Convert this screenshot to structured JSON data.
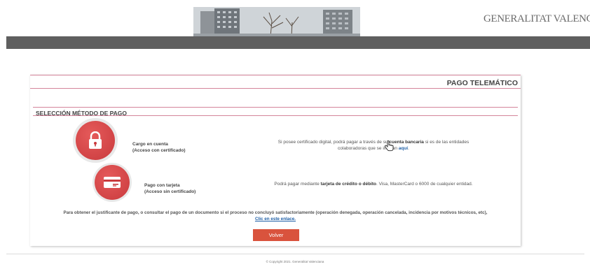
{
  "header": {
    "logo_text": "GENERALITAT VALENCIANA"
  },
  "panel": {
    "title": "PAGO TELEMÁTICO",
    "section_title": "SELECCIÓN MÉTODO DE PAGO",
    "options": [
      {
        "label_line1": "Cargo en cuenta",
        "label_line2": "(Acceso con certificado)",
        "desc_line1_pre": "Si posee certificado digital, podrá pagar a través de su ",
        "desc_line1_bold": "cuenta bancaria",
        "desc_line1_post": " si es de las entidades",
        "desc_line2_pre": "colaboradoras que se indican ",
        "desc_line2_link": "aquí",
        "desc_line2_post": ".",
        "icon": "lock-icon"
      },
      {
        "label_line1": "Pago con tarjeta",
        "label_line2": "(Acceso sin certificado)",
        "desc_pre": "Podrá pagar mediante ",
        "desc_bold": "tarjeta de crédito o débito",
        "desc_post": ". Visa, MasterCard o 6000 de cualquier entidad.",
        "icon": "credit-card-icon"
      }
    ],
    "justificante_text": "Para obtener el justificante de pago, o consultar el pago de un documento si el proceso no concluyó satisfactoriamente (operación denegada, operación cancelada, incidencia por motivos técnicos, etc),",
    "clic_link": "Clic en este enlace.",
    "volver_label": "Volver"
  },
  "footer": {
    "copyright": "© Copyright 2021. Generalitat Valenciana"
  },
  "colors": {
    "accent_red": "#d9533d",
    "circle_red": "#c93a3d",
    "pink_rule": "#d4849a",
    "topbar_gray": "#5f5f5f",
    "link_blue": "#1f5fa6"
  }
}
